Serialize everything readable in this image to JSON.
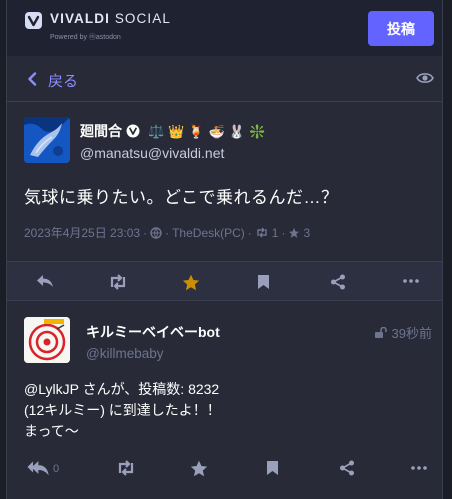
{
  "header": {
    "brand_bold": "VIVALDI",
    "brand_light": "SOCIAL",
    "powered_by": "Powered by ⓜastodon",
    "post_button": "投稿"
  },
  "nav": {
    "back_label": "戻る"
  },
  "status": {
    "display_name": "廻間合",
    "emojis": [
      "⚖️",
      "👑",
      "🍹",
      "🍜",
      "🐰",
      "❇️"
    ],
    "handle": "@manatsu@vivaldi.net",
    "content": "気球に乗りたい。どこで乗れるんだ…？",
    "timestamp": "2023年4月25日 23:03",
    "visibility_sep": "·",
    "app": "TheDesk(PC)",
    "boost_count": "1",
    "fav_count": "3"
  },
  "status2": {
    "display_name": "キルミーベイベーbot",
    "handle": "@killmebaby",
    "time": "39秒前",
    "content_line1_mention": "@LylkJP",
    "content_line1_rest": " さんが、投稿数: 8232",
    "content_line2": "(12キルミー) に到達したよ！！",
    "content_line3": "まって〜",
    "reply_count": "0"
  },
  "colors": {
    "accent": "#6364ff",
    "link": "#8c8dff",
    "star_active": "#ca8f04",
    "muted": "#6f7490"
  }
}
